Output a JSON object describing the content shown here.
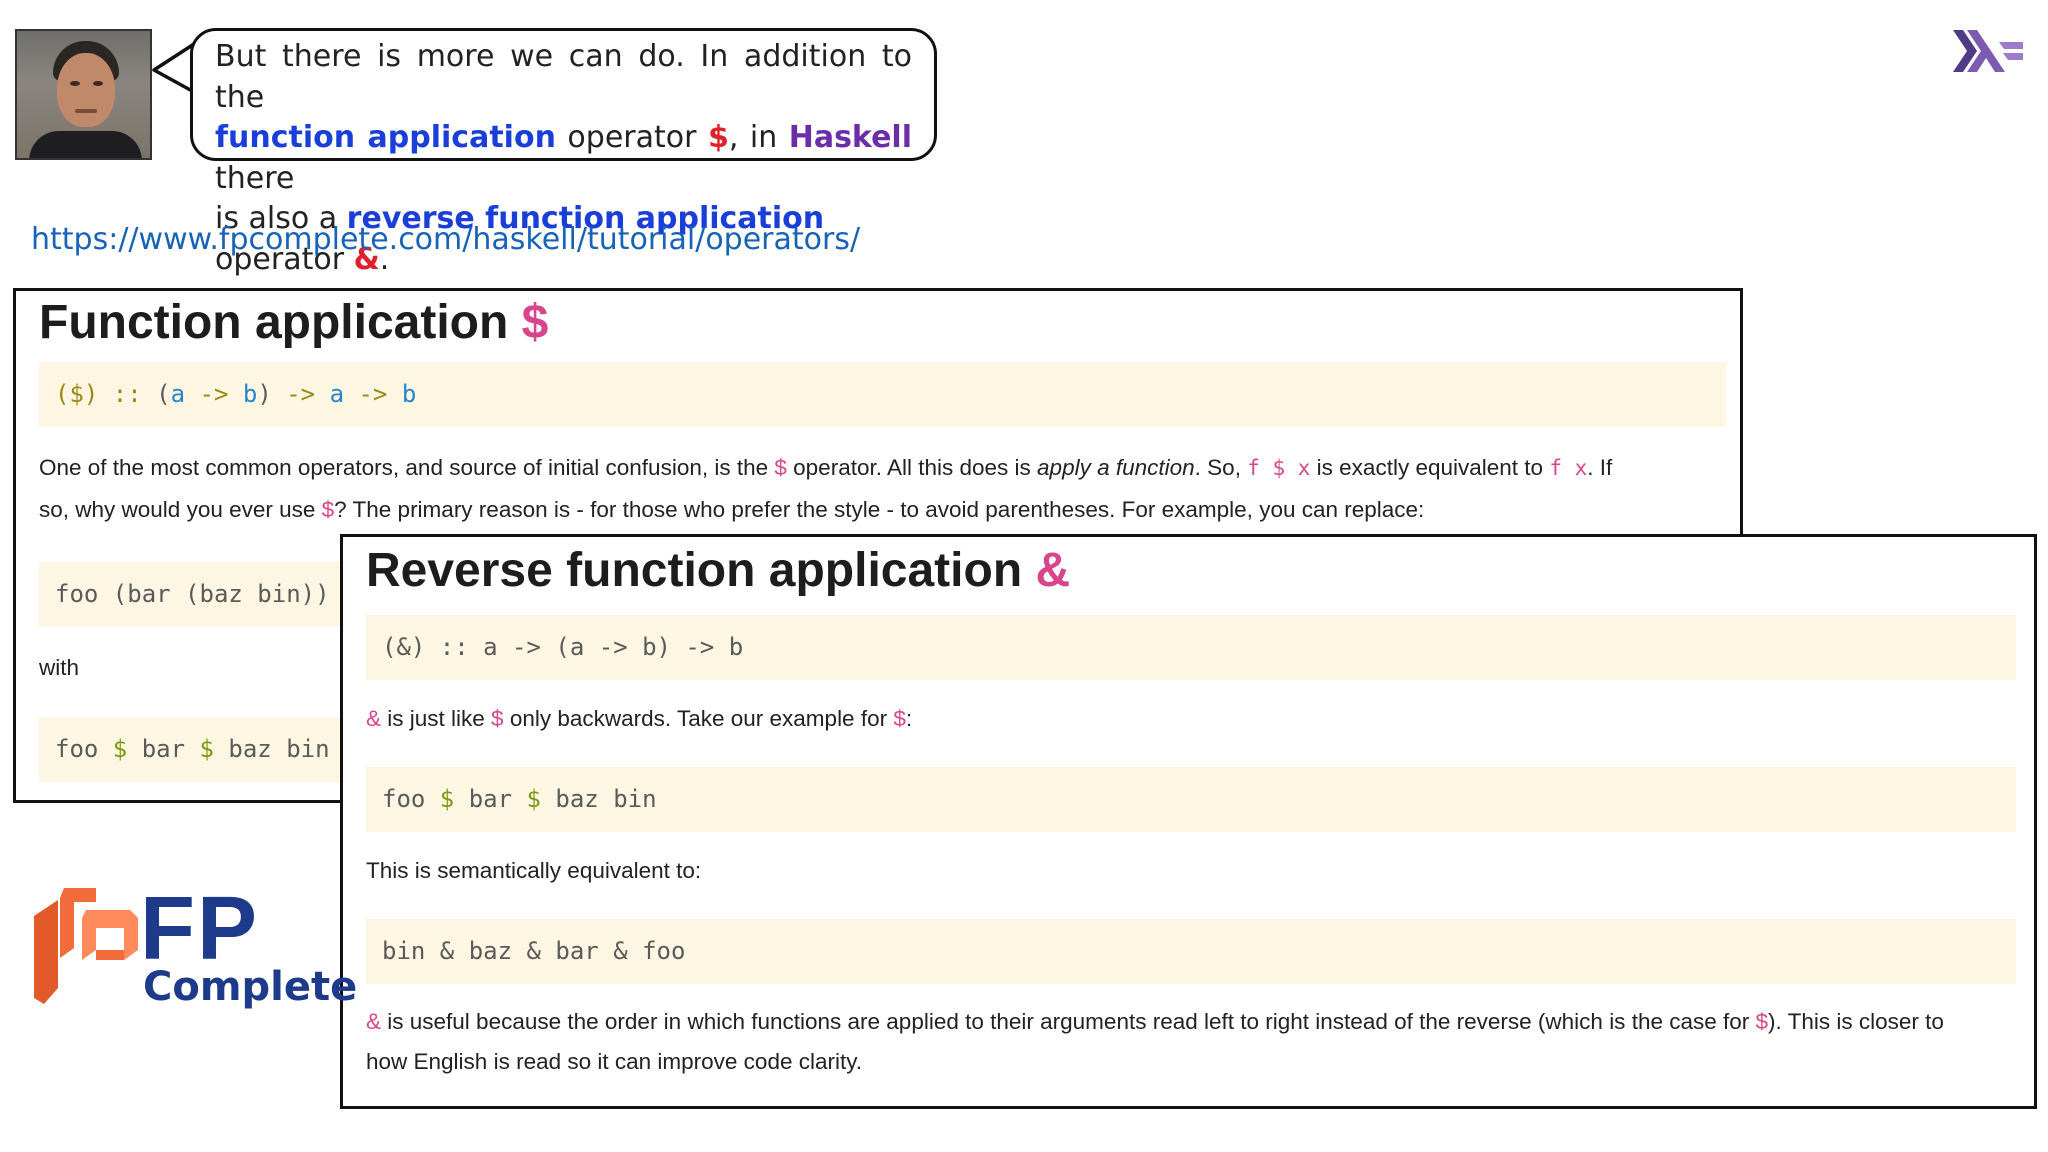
{
  "bubble": {
    "line1_a": "But there is more we can do. In addition to the",
    "line2_fa": "function application",
    "line2_b": " operator ",
    "line2_dollar": "$",
    "line2_c": ", in ",
    "line2_haskell": "Haskell",
    "line2_d": " there",
    "line3_a": "is also a ",
    "line3_rfa": "reverse function application",
    "line3_b": " operator ",
    "line3_amp": "&",
    "line3_c": "."
  },
  "url": "https://www.fpcomplete.com/haskell/tutorial/operators/",
  "card1": {
    "title": "Function application ",
    "title_symbol": "$",
    "sig": {
      "p1": "($)",
      "p2": " :: ",
      "p3": "(",
      "p4": "a",
      "p5": " -> ",
      "p6": "b",
      "p7": ")",
      "p8": " -> ",
      "p9": "a",
      "p10": " -> ",
      "p11": "b"
    },
    "para1_a": "One of the most common operators, and source of initial confusion, is the ",
    "para1_dollar": "$",
    "para1_b": " operator. All this does is ",
    "para1_em": "apply a function",
    "para1_c": ". So, ",
    "para1_code1": "f $ x",
    "para1_d": " is exactly equivalent to ",
    "para1_code2": "f x",
    "para1_e": ". If",
    "para2_a": "so, why would you ever use ",
    "para2_dollar": "$",
    "para2_b": "? The primary reason is - for those who prefer the style - to avoid parentheses. For example, you can replace:",
    "code1": "foo (bar (baz bin))",
    "with": "with",
    "code2": {
      "a": "foo ",
      "d1": "$",
      "b": " bar ",
      "d2": "$",
      "c": " baz bin"
    }
  },
  "card2": {
    "title": "Reverse function application ",
    "title_symbol": "&",
    "sig": "(&) :: a -> (a -> b) -> b",
    "p1_amp": "&",
    "p1_a": " is just like ",
    "p1_dollar": "$",
    "p1_b": " only backwards. Take our example for ",
    "p1_dollar2": "$",
    "p1_c": ":",
    "code1": {
      "a": "foo ",
      "d1": "$",
      "b": " bar ",
      "d2": "$",
      "c": " baz bin"
    },
    "p2": "This is semantically equivalent to:",
    "code2": "bin & baz & bar & foo",
    "p3_amp": "&",
    "p3_a": " is useful because the order in which functions are applied to their arguments read left to right instead of the reverse (which is the case for ",
    "p3_dollar": "$",
    "p3_b": "). This is closer to",
    "p4": "how English is read so it can improve code clarity."
  },
  "logo": {
    "fp": "FP",
    "complete": "Complete"
  },
  "icons": {
    "haskell": "haskell-logo-icon",
    "fp_complete": "fp-complete-logo-icon"
  },
  "colors": {
    "accent_pink": "#d8458a",
    "link_blue": "#1763b8",
    "code_bg": "#fdf6e3",
    "bubble_blue": "#1a3fd8",
    "bubble_purple": "#6a2fa8",
    "bubble_red": "#e0212c"
  }
}
